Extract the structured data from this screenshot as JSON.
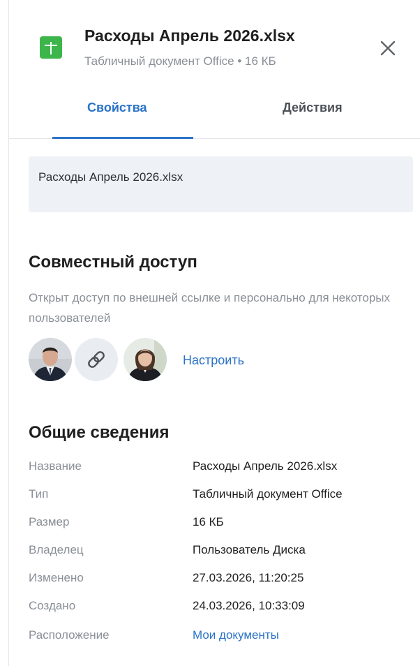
{
  "header": {
    "title": "Расходы Апрель 2026.xlsx",
    "subtitle": "Табличный документ Office • 16 КБ",
    "file_icon": "spreadsheet-icon",
    "file_icon_color": "#3cb54a",
    "close_icon": "close-icon"
  },
  "tabs": [
    {
      "label": "Свойства",
      "active": true
    },
    {
      "label": "Действия",
      "active": false
    }
  ],
  "name_field": {
    "value": "Расходы Апрель 2026.xlsx"
  },
  "sharing": {
    "heading": "Совместный доступ",
    "description": "Открыт доступ по внешней ссылке и персонально для некоторых пользователей",
    "avatars": [
      "user-avatar-man",
      "link-icon",
      "user-avatar-woman"
    ],
    "configure_label": "Настроить"
  },
  "general": {
    "heading": "Общие сведения",
    "rows": [
      {
        "label": "Название",
        "value": "Расходы Апрель 2026.xlsx"
      },
      {
        "label": "Тип",
        "value": "Табличный документ Office"
      },
      {
        "label": "Размер",
        "value": "16 КБ"
      },
      {
        "label": "Владелец",
        "value": "Пользователь Диска"
      },
      {
        "label": "Изменено",
        "value": "27.03.2026, 11:20:25"
      },
      {
        "label": "Создано",
        "value": "24.03.2026, 10:33:09"
      },
      {
        "label": "Расположение",
        "value": "Мои документы"
      }
    ]
  },
  "colors": {
    "accent": "#2a73c7",
    "muted_text": "#8a8f96",
    "name_box_bg": "#eef2f7"
  }
}
